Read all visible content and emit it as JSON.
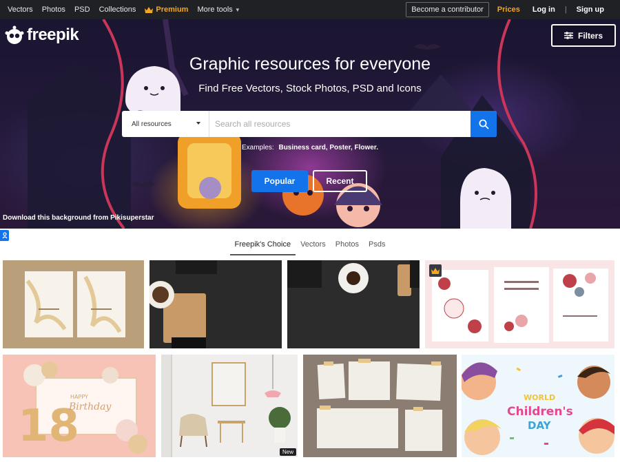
{
  "topnav": {
    "links": [
      "Vectors",
      "Photos",
      "PSD",
      "Collections"
    ],
    "premium": "Premium",
    "more_tools": "More tools",
    "contributor": "Become a contributor",
    "prices": "Prices",
    "login": "Log in",
    "sep": "|",
    "signup": "Sign up"
  },
  "hero": {
    "logo": "freepik",
    "filters": "Filters",
    "title": "Graphic resources for everyone",
    "subtitle": "Find Free Vectors, Stock Photos, PSD and Icons",
    "category": "All resources",
    "search_placeholder": "Search all resources",
    "examples_label": "Examples:",
    "examples": "Business card, Poster, Flower.",
    "popular": "Popular",
    "recent": "Recent",
    "credit": "Download this background from Pikisuperstar"
  },
  "tabs": [
    "Freepik's Choice",
    "Vectors",
    "Photos",
    "Psds"
  ],
  "tiles": {
    "new_badge": "New"
  },
  "colors": {
    "accent": "#1273eb",
    "premium": "#f5a623",
    "nav_bg": "#202124"
  }
}
